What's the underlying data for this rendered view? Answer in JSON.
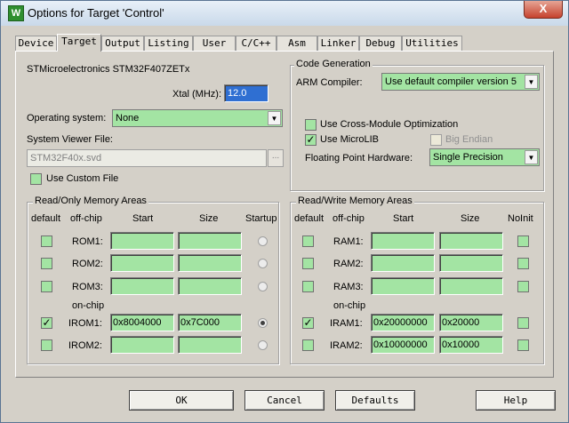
{
  "window": {
    "title": "Options for Target 'Control'",
    "app_icon": "W",
    "close_glyph": "X"
  },
  "tabs": [
    "Device",
    "Target",
    "Output",
    "Listing",
    "User",
    "C/C++",
    "Asm",
    "Linker",
    "Debug",
    "Utilities"
  ],
  "active_tab": "Target",
  "device": {
    "name": "STMicroelectronics STM32F407ZETx",
    "xtal_label": "Xtal (MHz):",
    "xtal_value": "12.0",
    "os_label": "Operating system:",
    "os_value": "None",
    "svf_label": "System Viewer File:",
    "svf_value": "STM32F40x.svd",
    "browse": "...",
    "custom_file_label": "Use Custom File"
  },
  "codegen": {
    "legend": "Code Generation",
    "compiler_label": "ARM Compiler:",
    "compiler_value": "Use default compiler version 5",
    "cross_module": {
      "label": "Use Cross-Module Optimization",
      "checked": false
    },
    "microlib": {
      "label": "Use MicroLIB",
      "checked": true
    },
    "big_endian": {
      "label": "Big Endian",
      "checked": false
    },
    "fpu_label": "Floating Point Hardware:",
    "fpu_value": "Single Precision"
  },
  "ro_memory": {
    "legend": "Read/Only Memory Areas",
    "headers": {
      "default": "default",
      "offchip": "off-chip",
      "start": "Start",
      "size": "Size",
      "extra": "Startup"
    },
    "onchip_label": "on-chip",
    "rows": [
      {
        "name": "ROM1:",
        "default": false,
        "start": "",
        "size": "",
        "startup": false
      },
      {
        "name": "ROM2:",
        "default": false,
        "start": "",
        "size": "",
        "startup": false
      },
      {
        "name": "ROM3:",
        "default": false,
        "start": "",
        "size": "",
        "startup": false
      },
      {
        "name": "IROM1:",
        "default": true,
        "start": "0x8004000",
        "size": "0x7C000",
        "startup": true
      },
      {
        "name": "IROM2:",
        "default": false,
        "start": "",
        "size": "",
        "startup": false
      }
    ]
  },
  "rw_memory": {
    "legend": "Read/Write Memory Areas",
    "headers": {
      "default": "default",
      "offchip": "off-chip",
      "start": "Start",
      "size": "Size",
      "extra": "NoInit"
    },
    "onchip_label": "on-chip",
    "rows": [
      {
        "name": "RAM1:",
        "default": false,
        "start": "",
        "size": "",
        "noinit": false
      },
      {
        "name": "RAM2:",
        "default": false,
        "start": "",
        "size": "",
        "noinit": false
      },
      {
        "name": "RAM3:",
        "default": false,
        "start": "",
        "size": "",
        "noinit": false
      },
      {
        "name": "IRAM1:",
        "default": true,
        "start": "0x20000000",
        "size": "0x20000",
        "noinit": false
      },
      {
        "name": "IRAM2:",
        "default": false,
        "start": "0x10000000",
        "size": "0x10000",
        "noinit": false
      }
    ]
  },
  "buttons": {
    "ok": "OK",
    "cancel": "Cancel",
    "defaults": "Defaults",
    "help": "Help"
  },
  "colors": {
    "field_green": "#a3e4a3",
    "dialog_gray": "#d4d0c8",
    "close_red": "#c6422e"
  }
}
